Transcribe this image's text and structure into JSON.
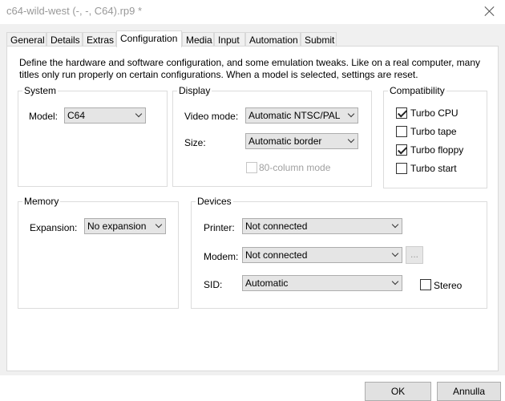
{
  "window": {
    "title": "c64-wild-west (-, -, C64).rp9 *",
    "close_icon": "close-icon"
  },
  "tabs": [
    {
      "label": "General"
    },
    {
      "label": "Details"
    },
    {
      "label": "Extras"
    },
    {
      "label": "Configuration"
    },
    {
      "label": "Media"
    },
    {
      "label": "Input"
    },
    {
      "label": "Automation"
    },
    {
      "label": "Submit"
    }
  ],
  "active_tab": "Configuration",
  "description": "Define the hardware and software configuration, and some emulation tweaks. Like on a real computer, many titles only run properly on certain configurations. When a model is selected, settings are reset.",
  "system": {
    "title": "System",
    "model_label": "Model:",
    "model_value": "C64"
  },
  "display": {
    "title": "Display",
    "video_mode_label": "Video mode:",
    "video_mode_value": "Automatic NTSC/PAL",
    "size_label": "Size:",
    "size_value": "Automatic border",
    "col80_label": "80-column mode",
    "col80_checked": false,
    "col80_enabled": false
  },
  "compatibility": {
    "title": "Compatibility",
    "items": [
      {
        "label": "Turbo CPU",
        "checked": true
      },
      {
        "label": "Turbo tape",
        "checked": false
      },
      {
        "label": "Turbo floppy",
        "checked": true
      },
      {
        "label": "Turbo start",
        "checked": false
      }
    ]
  },
  "memory": {
    "title": "Memory",
    "expansion_label": "Expansion:",
    "expansion_value": "No expansion"
  },
  "devices": {
    "title": "Devices",
    "printer_label": "Printer:",
    "printer_value": "Not connected",
    "modem_label": "Modem:",
    "modem_value": "Not connected",
    "modem_browse_label": "...",
    "sid_label": "SID:",
    "sid_value": "Automatic",
    "stereo_label": "Stereo",
    "stereo_checked": false
  },
  "buttons": {
    "ok": "OK",
    "cancel": "Annulla"
  }
}
